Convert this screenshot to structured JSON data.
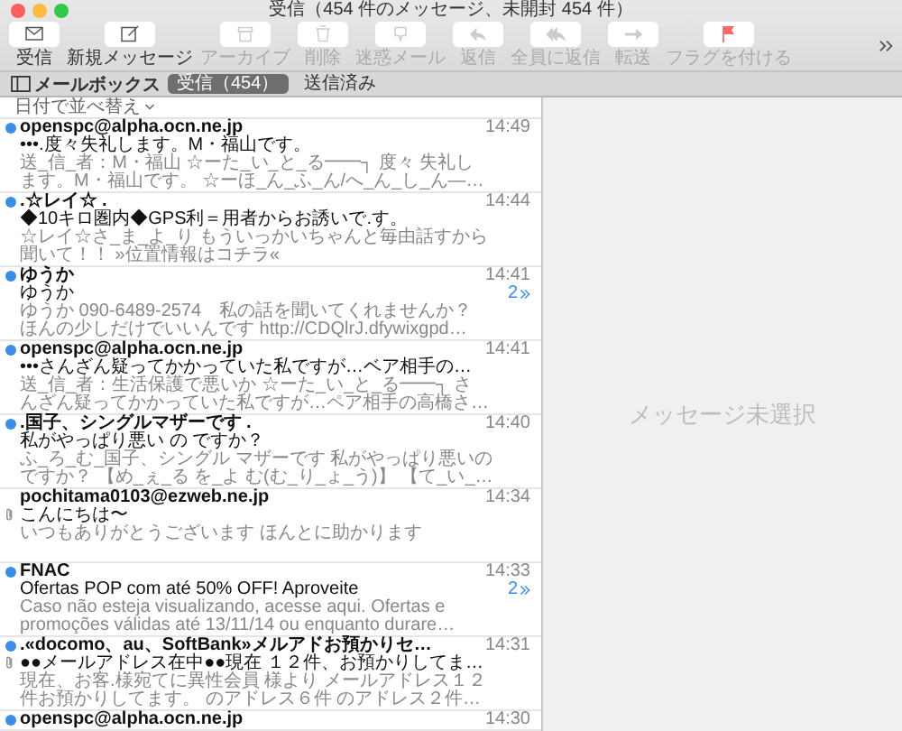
{
  "window": {
    "title": "受信（454 件のメッセージ、未開封 454 件）"
  },
  "toolbar": [
    {
      "kind": "inbox",
      "label": "受信",
      "disabled": false
    },
    {
      "kind": "compose",
      "label": "新規メッセージ",
      "disabled": false
    },
    {
      "kind": "archive",
      "label": "アーカイブ",
      "disabled": true
    },
    {
      "kind": "trash",
      "label": "削除",
      "disabled": true
    },
    {
      "kind": "junk",
      "label": "迷惑メール",
      "disabled": true
    },
    {
      "kind": "reply",
      "label": "返信",
      "disabled": true
    },
    {
      "kind": "replyall",
      "label": "全員に返信",
      "disabled": true
    },
    {
      "kind": "forward",
      "label": "転送",
      "disabled": true
    },
    {
      "kind": "flag",
      "label": "フラグを付ける",
      "disabled": true
    }
  ],
  "mailbox_bar": {
    "mailboxes_label": "メールボックス",
    "tabs": [
      {
        "label": "受信（454）",
        "selected": true
      },
      {
        "label": "送信済み",
        "selected": false
      }
    ]
  },
  "sort": {
    "label": "日付で並べ替え"
  },
  "messages": [
    {
      "sender": "openspc@alpha.ocn.ne.jp",
      "time": "14:49",
      "subject": "•••.度々失礼します。M・福山です。",
      "preview": [
        "送_信_者：M・福山 ☆ーた_い_と_る━━┐ 度々 失礼し",
        "ます。M・福山です。 ☆ーほ_ん_ふ_ん/へ_ん_し_ん―…"
      ],
      "unread": true,
      "attachment": false
    },
    {
      "sender": ".☆レイ☆ .",
      "time": "14:44",
      "subject": "◆10キロ圏内◆GPS利＝用者からお誘いで.す。",
      "preview": [
        "☆レイ☆さ_ま_よ_り もういっかいちゃんと毎由話すから",
        "聞いて！！ »位置情報はコチラ«"
      ],
      "unread": true,
      "attachment": false
    },
    {
      "sender": "ゆうか",
      "time": "14:41",
      "subject": "ゆうか",
      "thread_count": "2",
      "preview": [
        "ゆうか 090-6489-2574　私の話を聞いてくれませんか？",
        "ほんの少しだけでいいんです http://CDQlrJ.dfywixgpd…"
      ],
      "unread": true,
      "attachment": false
    },
    {
      "sender": "openspc@alpha.ocn.ne.jp",
      "time": "14:41",
      "subject": "•••さんざん疑ってかかっていた私ですが…ベア相手の…",
      "preview": [
        "送_信_者：生活保護で悪いか ☆ーた_い_と_る━━┐ さ",
        "んざん疑ってかかっていた私ですが…ペア相手の高橋さ…"
      ],
      "unread": true,
      "attachment": false
    },
    {
      "sender": ".国子、シングルマザーです .",
      "time": "14:40",
      "subject": "私がやっぱり悪い の ですか？",
      "preview": [
        "ふ_ろ_む_国子、シングル マザーです 私がやっぱり悪いの",
        "ですか？ 【め_ぇ_る を_よ む(む_り_ょ_う)】 【て_い_…"
      ],
      "unread": true,
      "attachment": false
    },
    {
      "sender": "pochitama0103@ezweb.ne.jp",
      "time": "14:34",
      "subject": "こんにちは〜",
      "preview": [
        "いつもありがとうございます ほんとに助かります"
      ],
      "unread": false,
      "attachment": true
    },
    {
      "sender": "FNAC",
      "time": "14:33",
      "subject": "Ofertas POP com até 50% OFF! Aproveite",
      "thread_count": "2",
      "preview": [
        "Caso não esteja visualizando, acesse aqui. Ofertas e",
        "promoções válidas até 13/11/14 ou enquanto durare…"
      ],
      "unread": true,
      "attachment": false
    },
    {
      "sender": ".«docomo、au、SoftBank»メルアドお預かりセ…",
      "time": "14:31",
      "subject": "●●メールアドレス在中●●現在 １２件、お預かりしてま…",
      "preview": [
        "現在、お客.様宛てに異性会員 様より メールアドレス１２",
        "件お預かりしてます。 のアドレス６件 のアドレス２件…"
      ],
      "unread": true,
      "attachment": true
    },
    {
      "sender": "openspc@alpha.ocn.ne.jp",
      "time": "14:30",
      "unread": true,
      "attachment": false
    }
  ],
  "viewer": {
    "empty_text": "メッセージ未選択"
  }
}
